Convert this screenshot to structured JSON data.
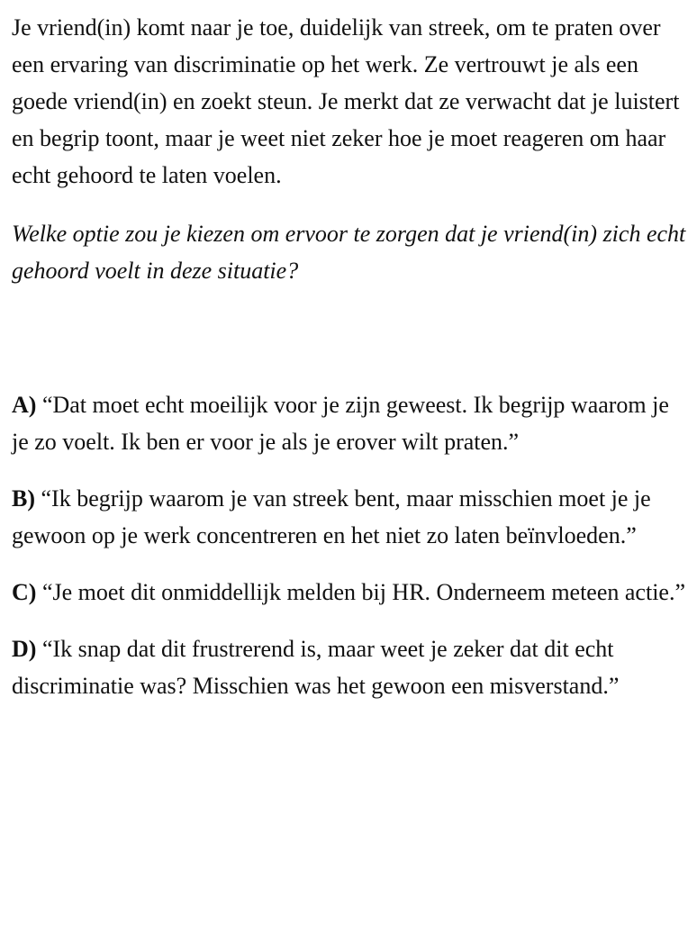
{
  "scenario": "Je vriend(in) komt naar je toe, duidelijk van streek, om te praten over een ervaring van discriminatie op het werk. Ze vertrouwt je als een goede vriend(in) en zoekt steun. Je merkt dat ze verwacht dat je luistert en begrip toont, maar je weet niet zeker hoe je moet reageren om haar echt gehoord te laten voelen.",
  "question": "Welke optie zou je kiezen om ervoor te zorgen dat je vriend(in) zich echt gehoord  voelt in deze situatie?",
  "options": [
    {
      "letter": "A)",
      "text": "“Dat moet echt moeilijk voor je zijn geweest. Ik begrijp waarom je je zo voelt. Ik ben er voor je als je erover wilt praten.”"
    },
    {
      "letter": "B)",
      "text": "“Ik begrijp waarom je van streek bent, maar misschien moet je je gewoon op je werk concentreren en het niet zo laten beïnvloeden.”"
    },
    {
      "letter": "C)",
      "text": "“Je moet dit onmiddellijk melden bij HR. Onderneem meteen actie.”"
    },
    {
      "letter": "D)",
      "text": "“Ik snap dat dit frustrerend is, maar weet je zeker dat dit echt discriminatie was? Misschien was het gewoon een misverstand.”"
    }
  ]
}
